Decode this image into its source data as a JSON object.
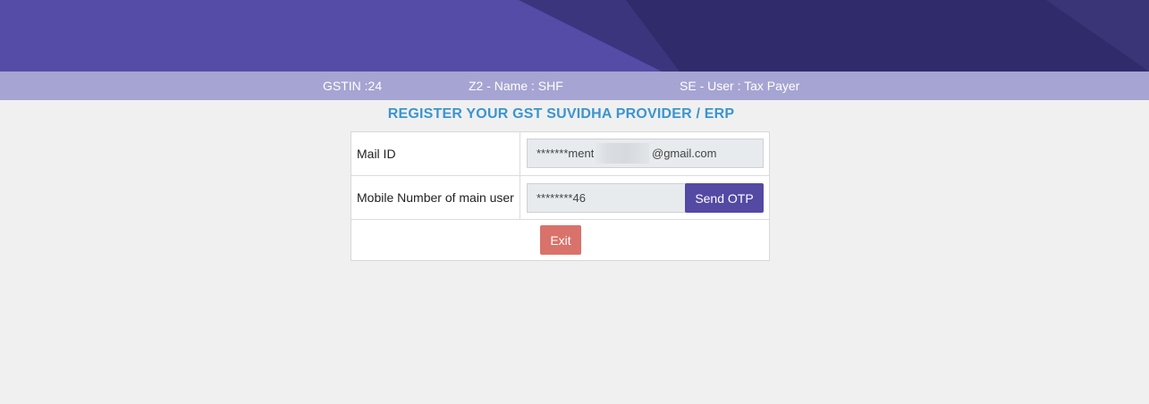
{
  "header": {
    "gstin_label": "GSTIN :24",
    "name_fragment": "Z2 - Name : SHF",
    "user_fragment": "SE - User : Tax Payer"
  },
  "page_title": "REGISTER YOUR GST SUVIDHA PROVIDER / ERP",
  "form": {
    "mail_label": "Mail ID",
    "mail_prefix": "*******ment",
    "mail_suffix": "@gmail.com",
    "mobile_label": "Mobile Number of main user",
    "mobile_value": "********46",
    "send_otp_label": "Send OTP",
    "exit_label": "Exit"
  },
  "colors": {
    "banner": "#544ca6",
    "banner_dark": "#2f2b68",
    "info_bar": "#a6a4d2",
    "title": "#3a95d0",
    "send_otp": "#5449a3",
    "exit": "#d9726a"
  }
}
